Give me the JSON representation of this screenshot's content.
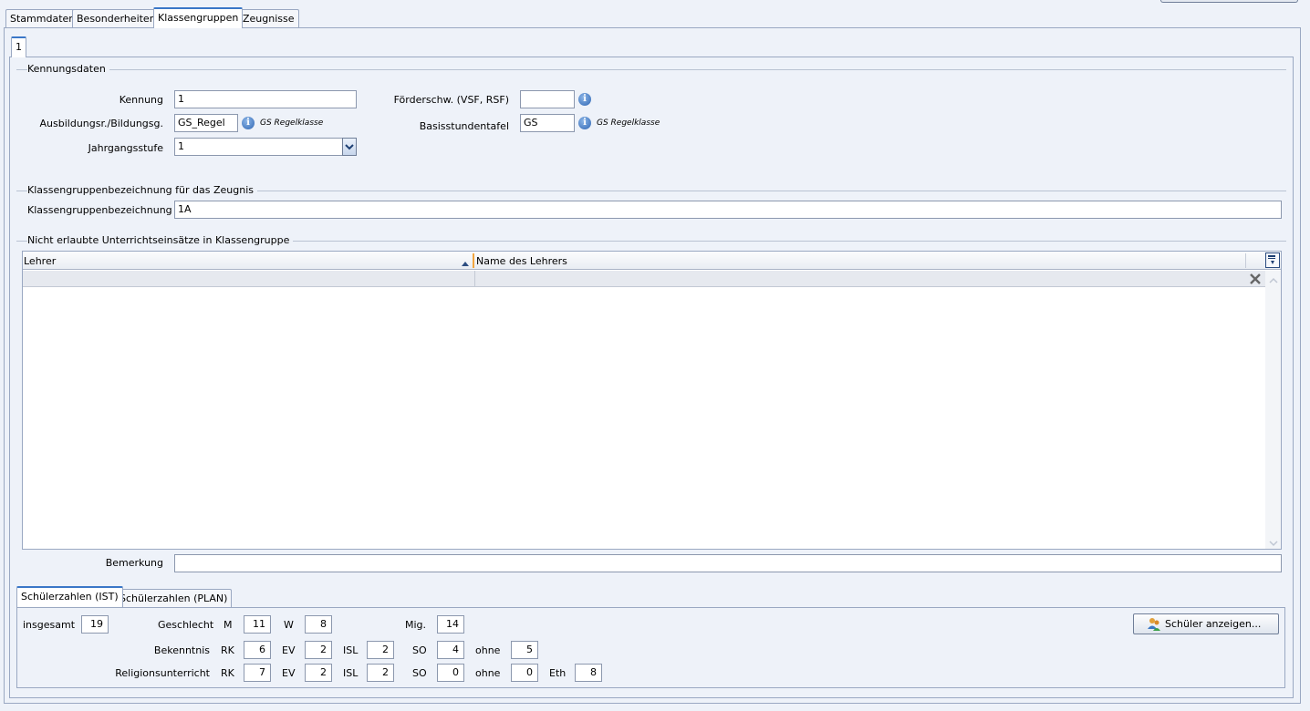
{
  "main_tabs": [
    "Stammdaten",
    "Besonderheiten",
    "Klassengruppen",
    "Zeugnisse"
  ],
  "group_tab": "1",
  "kennungsdaten": {
    "title": "Kennungsdaten",
    "kennung_label": "Kennung",
    "kennung_value": "1",
    "ausbildung_label": "Ausbildungsr./Bildungsg.",
    "ausbildung_value": "GS_Regel",
    "ausbildung_hint": "GS Regelklasse",
    "jahrgang_label": "Jahrgangsstufe",
    "jahrgang_value": "1",
    "foerder_label": "Förderschw. (VSF, RSF)",
    "foerder_value": "",
    "basis_label": "Basisstundentafel",
    "basis_value": "GS",
    "basis_hint": "GS Regelklasse",
    "info_glyph": "i"
  },
  "bezeichnung": {
    "title": "Klassengruppenbezeichnung für das Zeugnis",
    "label": "Klassengruppenbezeichnung",
    "value": "1A"
  },
  "unterricht": {
    "title": "Nicht erlaubte Unterrichtseinsätze in Klassengruppe",
    "columns": [
      "Lehrer",
      "Name des Lehrers"
    ],
    "rows": []
  },
  "bemerkung": {
    "label": "Bemerkung",
    "value": ""
  },
  "count_tabs": [
    "Schülerzahlen (IST)",
    "Schülerzahlen (PLAN)"
  ],
  "counts": {
    "insgesamt_label": "insgesamt",
    "insgesamt": "19",
    "geschlecht_label": "Geschlecht",
    "m_label": "M",
    "m": "11",
    "w_label": "W",
    "w": "8",
    "mig_label": "Mig.",
    "mig": "14",
    "bekenntnis_label": "Bekenntnis",
    "bek": {
      "rk_label": "RK",
      "rk": "6",
      "ev_label": "EV",
      "ev": "2",
      "isl_label": "ISL",
      "isl": "2",
      "so_label": "SO",
      "so": "4",
      "ohne_label": "ohne",
      "ohne": "5"
    },
    "religion_label": "Religionsunterricht",
    "rel": {
      "rk_label": "RK",
      "rk": "7",
      "ev_label": "EV",
      "ev": "2",
      "isl_label": "ISL",
      "isl": "2",
      "so_label": "SO",
      "so": "0",
      "ohne_label": "ohne",
      "ohne": "0",
      "eth_label": "Eth",
      "eth": "8"
    }
  },
  "show_students_button": "Schüler anzeigen...",
  "icons": [
    "info-icon",
    "sort-asc-icon",
    "column-chooser-icon",
    "clear-filter-icon",
    "dropdown-arrow-icon",
    "students-icon",
    "scroll-up-icon",
    "scroll-down-icon"
  ],
  "colors": {
    "background": "#eef2f9",
    "accent": "#3a77c8",
    "border": "#9aa8c2"
  }
}
